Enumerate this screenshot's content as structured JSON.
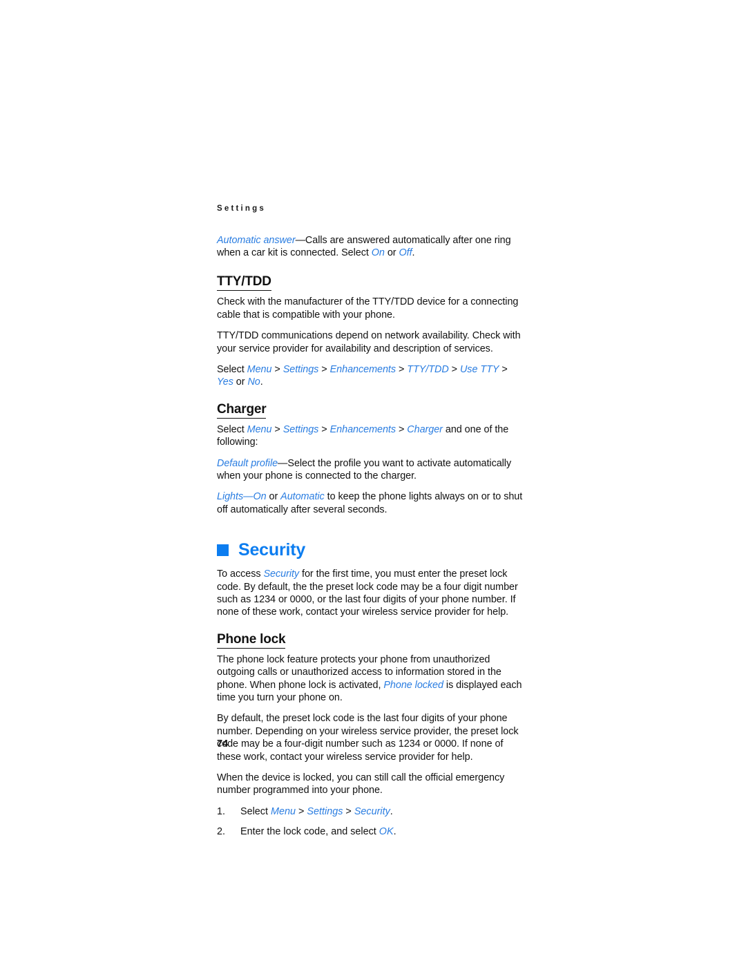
{
  "page": {
    "running_header": "Settings",
    "page_number": "74"
  },
  "colors": {
    "accent_blue": "#0c7df0",
    "inline_blue": "#2a7de1",
    "text_black": "#111111",
    "background": "#ffffff"
  },
  "automatic_answer": {
    "term": "Automatic answer",
    "dash": "—",
    "text_1": "Calls are answered automatically after one ring when a car kit is connected. Select ",
    "option_on": "On",
    "conjunction": " or ",
    "option_off": "Off",
    "period": "."
  },
  "tty_tdd": {
    "heading": "TTY/TDD",
    "paragraph_1": "Check with the manufacturer of the TTY/TDD device for a connecting cable that is compatible with your phone.",
    "paragraph_2": "TTY/TDD communications depend on network availability. Check with your service provider for availability and description of services.",
    "path": {
      "lead": "Select ",
      "items": [
        "Menu",
        "Settings",
        "Enhancements",
        "TTY/TDD",
        "Use TTY",
        "Yes"
      ],
      "separator": " > ",
      "conjunction": " or ",
      "last_item": "No",
      "period": "."
    }
  },
  "charger": {
    "heading": "Charger",
    "path": {
      "lead": "Select ",
      "items": [
        "Menu",
        "Settings",
        "Enhancements",
        "Charger"
      ],
      "separator": " > ",
      "trailing": " and one of the following:"
    },
    "default_profile": {
      "term": "Default profile",
      "dash": "—",
      "text": "Select the profile you want to activate automatically when your phone is connected to the charger."
    },
    "lights": {
      "term": "Lights",
      "dash": "—",
      "option_on": "On",
      "conjunction": " or ",
      "option_automatic": "Automatic",
      "text": " to keep the phone lights always on or to shut off automatically after several seconds."
    }
  },
  "security": {
    "heading": "Security",
    "bullet_icon": "blue-square-bullet",
    "intro": {
      "lead": "To access ",
      "term": "Security",
      "text": " for the first time, you must enter the preset lock code. By default, the the preset lock code may be a four digit number such as 1234 or 0000, or the last four digits of your phone number. If none of these work, contact your wireless service provider for help."
    }
  },
  "phone_lock": {
    "heading": "Phone lock",
    "paragraph_1": {
      "text_before": "The phone lock feature protects your phone from unauthorized outgoing calls or unauthorized access to information stored in the phone. When phone lock is activated, ",
      "term": "Phone locked",
      "text_after": " is displayed each time you turn your phone on."
    },
    "paragraph_2": "By default, the preset lock code is the last four digits of your phone number. Depending on your wireless service provider, the preset lock code may be a four-digit number such as 1234 or 0000. If none of these work, contact your wireless service provider for help.",
    "paragraph_3": "When the device is locked, you can still call the official emergency number programmed into your phone.",
    "steps": [
      {
        "number": "1.",
        "lead": "Select ",
        "items": [
          "Menu",
          "Settings",
          "Security"
        ],
        "separator": " > ",
        "period": "."
      },
      {
        "number": "2.",
        "lead": "Enter the lock code, and select ",
        "items": [
          "OK"
        ],
        "separator": " > ",
        "period": "."
      }
    ]
  }
}
